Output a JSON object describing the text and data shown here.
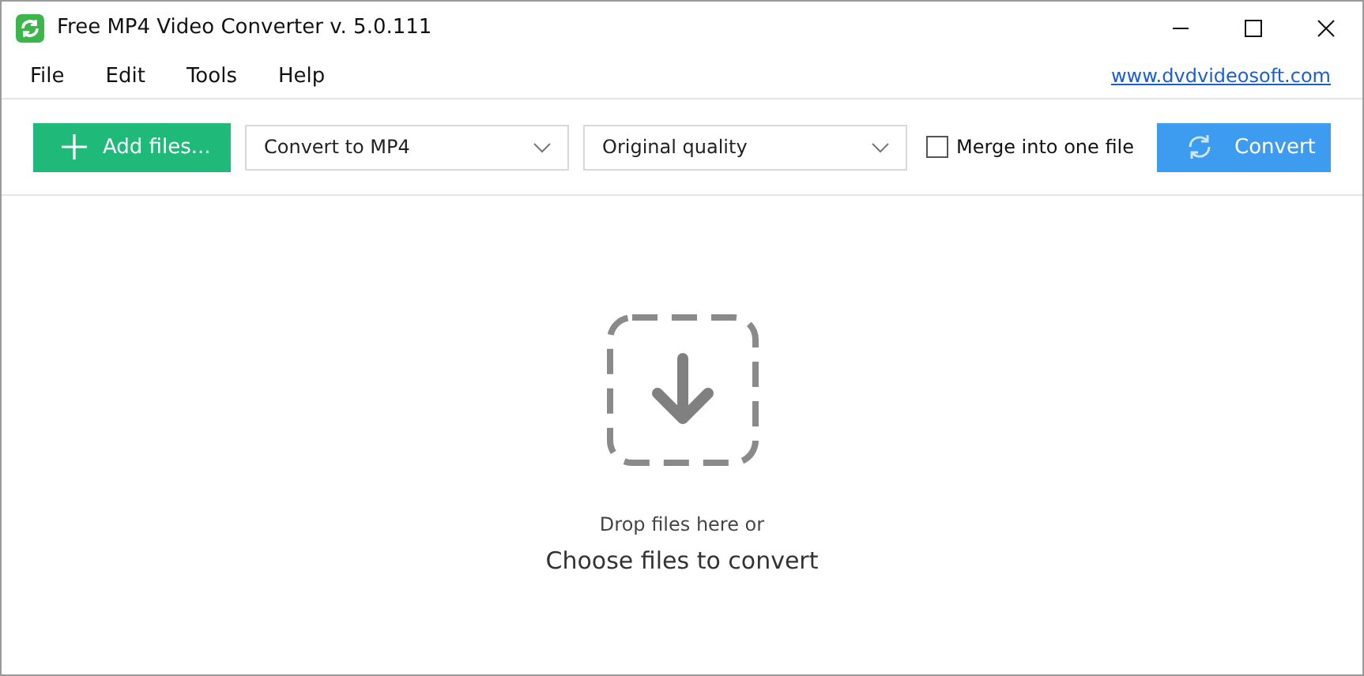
{
  "window": {
    "title": "Free MP4 Video Converter v. 5.0.111"
  },
  "menu": [
    "File",
    "Edit",
    "Tools",
    "Help"
  ],
  "website_link": "www.dvdvideosoft.com",
  "toolbar": {
    "add_button": "Add files...",
    "format_select": {
      "value": "Convert to MP4"
    },
    "quality_select": {
      "value": "Original quality"
    },
    "merge_checkbox": {
      "label": "Merge into one file",
      "checked": false
    },
    "convert_button": "Convert"
  },
  "drop_area": {
    "hint": "Drop files here or",
    "link": "Choose files to convert"
  }
}
